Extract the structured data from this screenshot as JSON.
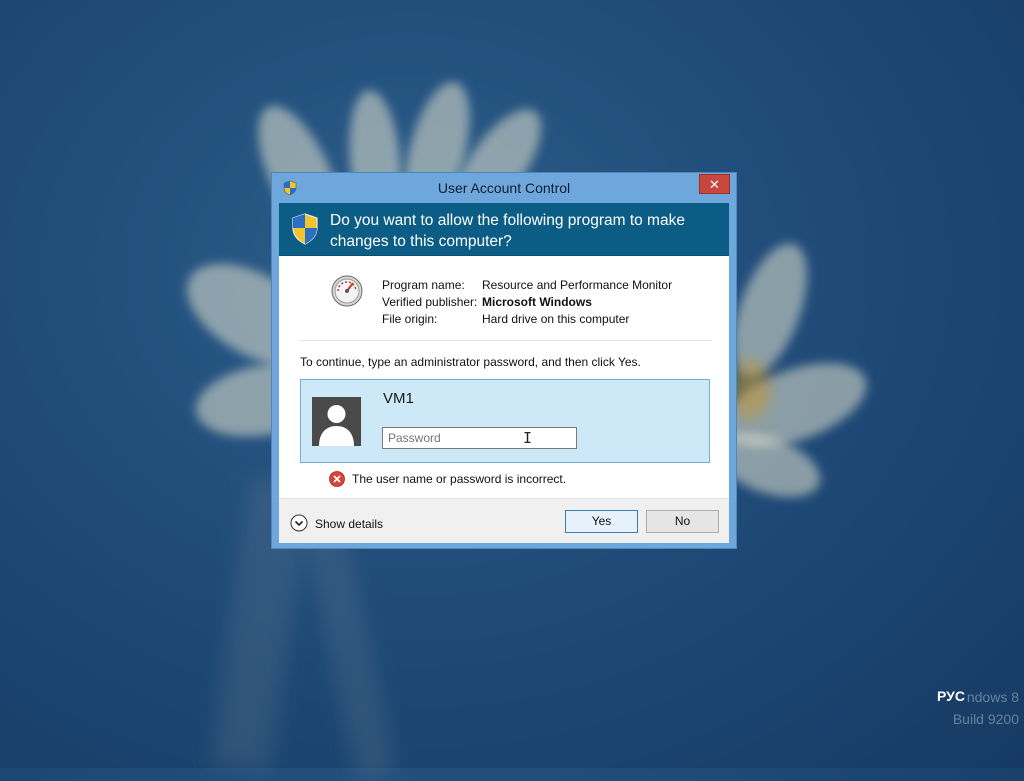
{
  "desktop": {
    "language_indicator": "РУС",
    "watermark_line1": "ndows 8",
    "watermark_line2": "Build 9200"
  },
  "dialog": {
    "title": "User Account Control",
    "close_glyph": "✕",
    "question": "Do you want to allow the following program to make changes to this computer?",
    "program": {
      "icon": "performance-monitor-icon",
      "rows": [
        {
          "label": "Program name:",
          "value": "Resource and Performance Monitor",
          "bold": false
        },
        {
          "label": "Verified publisher:",
          "value": "Microsoft Windows",
          "bold": true
        },
        {
          "label": "File origin:",
          "value": "Hard drive on this computer",
          "bold": false
        }
      ]
    },
    "prompt": "To continue, type an administrator password, and then click Yes.",
    "credential": {
      "username": "VM1",
      "password_placeholder": "Password",
      "password_value": ""
    },
    "error_message": "The user name or password is incorrect.",
    "show_details_label": "Show details",
    "yes_label": "Yes",
    "no_label": "No"
  },
  "colors": {
    "header_band": "#0c5d86",
    "frame": "#6ea7dc",
    "credential_box": "#cde8f6",
    "close_button": "#c7473e"
  }
}
